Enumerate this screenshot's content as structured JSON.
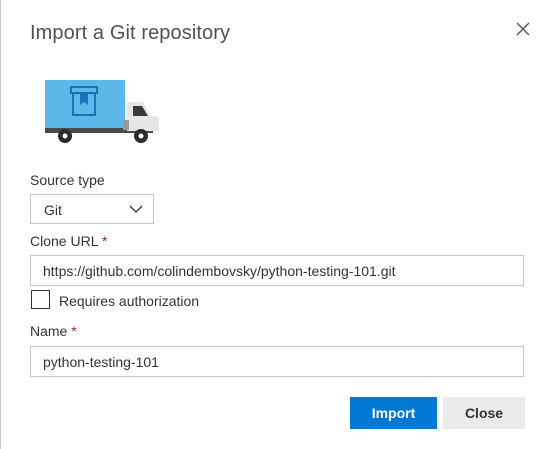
{
  "dialog": {
    "title": "Import a Git repository"
  },
  "source_type": {
    "label": "Source type",
    "selected": "Git"
  },
  "clone_url": {
    "label": "Clone URL",
    "required_marker": "*",
    "value": "https://github.com/colindembovsky/python-testing-101.git"
  },
  "authorization": {
    "label": "Requires authorization",
    "checked": false
  },
  "name": {
    "label": "Name",
    "required_marker": "*",
    "value": "python-testing-101"
  },
  "buttons": {
    "import_label": "Import",
    "close_label": "Close"
  },
  "colors": {
    "primary": "#0078d4",
    "truck_cargo": "#5bb8e8",
    "truck_cargo_dark": "#1b70b8",
    "required": "#a4262c"
  },
  "icons": {
    "close": "close-icon",
    "chevron": "chevron-down-icon",
    "illustration": "truck-illustration"
  }
}
